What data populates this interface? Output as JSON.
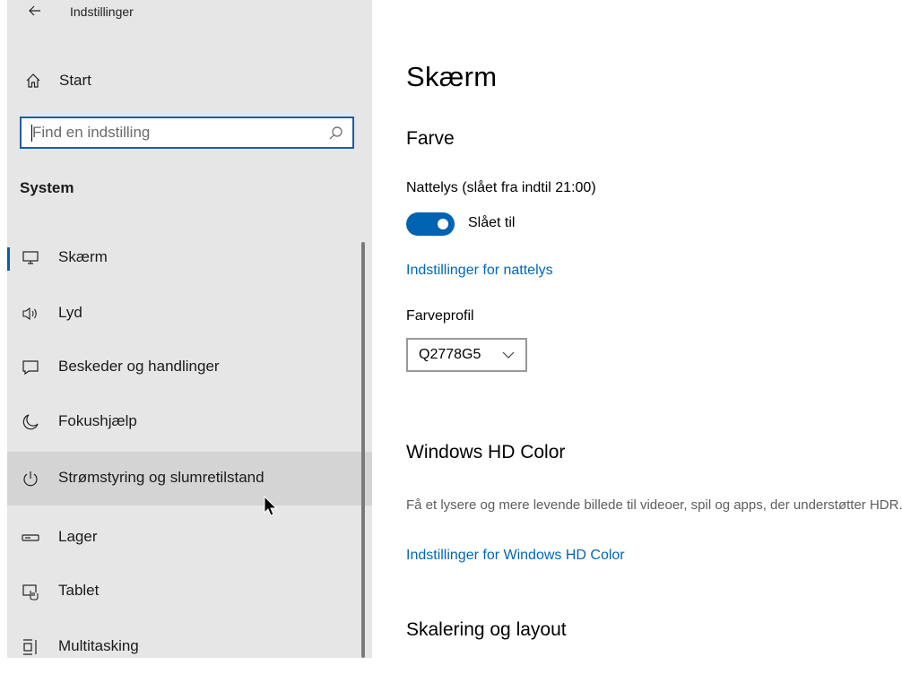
{
  "app": {
    "title": "Indstillinger"
  },
  "sidebar": {
    "home_label": "Start",
    "search": {
      "placeholder": "Find en indstilling",
      "value": ""
    },
    "section_title": "System",
    "items": [
      {
        "label": "Skærm",
        "icon": "monitor-icon"
      },
      {
        "label": "Lyd",
        "icon": "speaker-icon"
      },
      {
        "label": "Beskeder og handlinger",
        "icon": "message-icon"
      },
      {
        "label": "Fokushjælp",
        "icon": "moon-icon"
      },
      {
        "label": "Strømstyring og slumretilstand",
        "icon": "power-icon"
      },
      {
        "label": "Lager",
        "icon": "storage-icon"
      },
      {
        "label": "Tablet",
        "icon": "tablet-icon"
      },
      {
        "label": "Multitasking",
        "icon": "multitasking-icon"
      }
    ]
  },
  "main": {
    "title": "Skærm",
    "color_heading": "Farve",
    "nightlight_label": "Nattelys (slået fra indtil 21:00)",
    "toggle_state": "Slået til",
    "nightlight_settings_link": "Indstillinger for nattelys",
    "color_profile_label": "Farveprofil",
    "color_profile_value": "Q2778G5",
    "hd_heading": "Windows HD Color",
    "hd_description": "Få et lysere og mere levende billede til videoer, spil og apps, der understøtter HDR.",
    "hd_settings_link": "Indstillinger for Windows HD Color",
    "scale_heading": "Skalering og layout"
  },
  "colors": {
    "accent": "#0063b1",
    "link": "#0067b8",
    "sidebar_bg": "#e6e6e6",
    "hover_bg": "#d4d4d4"
  }
}
